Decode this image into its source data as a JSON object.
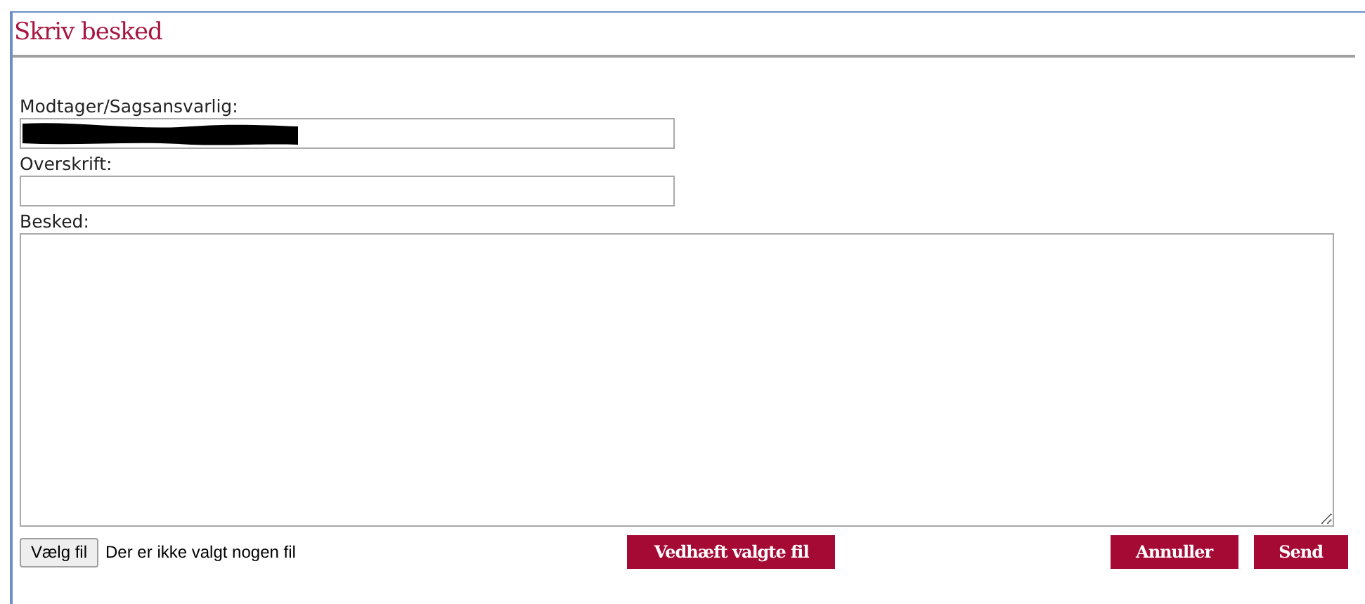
{
  "title": "Skriv besked",
  "fields": [
    {
      "label": "Modtager/Sagsansvarlig:",
      "kind": "redacted"
    },
    {
      "label": "Overskrift:",
      "kind": "input"
    },
    {
      "label": "Besked:",
      "kind": "textarea"
    }
  ],
  "file_picker": {
    "button": "Vælg fil",
    "status": "Der er ikke valgt nogen fil"
  },
  "attach_button": "Vedhæft valgte fil",
  "buttons": [
    "Annuller",
    "Send"
  ]
}
